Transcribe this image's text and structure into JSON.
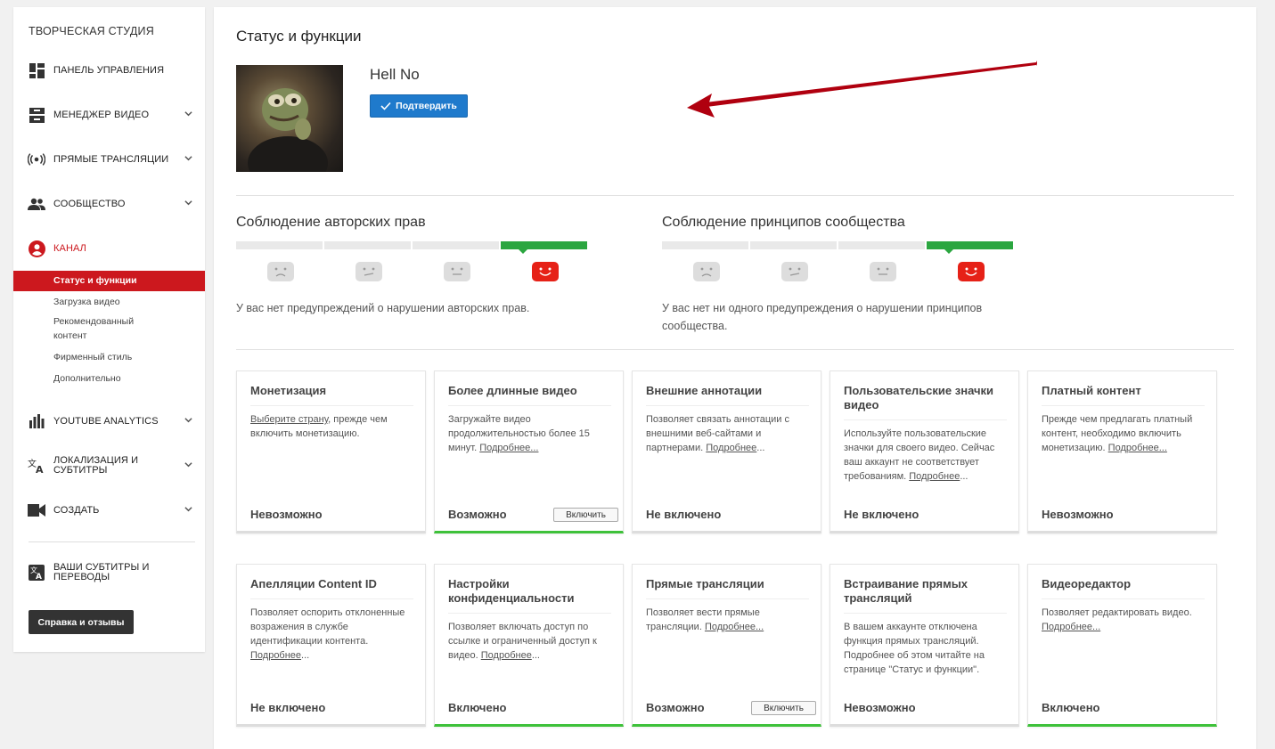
{
  "sidebar": {
    "title": "ТВОРЧЕСКАЯ СТУДИЯ",
    "items": [
      {
        "label": "ПАНЕЛЬ УПРАВЛЕНИЯ",
        "icon": "dashboard-icon"
      },
      {
        "label": "МЕНЕДЖЕР ВИДЕО",
        "icon": "video-manager-icon"
      },
      {
        "label": "ПРЯМЫЕ ТРАНСЛЯЦИИ",
        "icon": "live-icon"
      },
      {
        "label": "СООБЩЕСТВО",
        "icon": "community-icon"
      },
      {
        "label": "КАНАЛ",
        "icon": "channel-icon"
      },
      {
        "label": "YOUTUBE ANALYTICS",
        "icon": "analytics-icon"
      },
      {
        "label": "ЛОКАЛИЗАЦИЯ И СУБТИТРЫ",
        "icon": "translate-icon"
      },
      {
        "label": "СОЗДАТЬ",
        "icon": "create-icon"
      },
      {
        "label": "ВАШИ СУБТИТРЫ И ПЕРЕВОДЫ",
        "icon": "subtitles-icon"
      }
    ],
    "channel_sub": [
      "Статус и функции",
      "Загрузка видео",
      "Рекомендованный контент",
      "Фирменный стиль",
      "Дополнительно"
    ],
    "help_label": "Справка и отзывы"
  },
  "main": {
    "title": "Статус и функции",
    "channel_name": "Hell No",
    "verify_label": "Подтвердить",
    "copyright": {
      "title": "Соблюдение авторских прав",
      "text": "У вас нет предупреждений о нарушении авторских прав."
    },
    "community": {
      "title": "Соблюдение принципов сообщества",
      "text": "У вас нет ни одного предупреждения о нарушении принципов сообщества."
    }
  },
  "cards": [
    {
      "title": "Монетизация",
      "desc_pre": "",
      "link": "Выберите страну",
      "desc_post": ", прежде чем включить монетизацию.",
      "status": "Невозможно",
      "button": "",
      "green": false
    },
    {
      "title": "Более длинные видео",
      "desc_pre": "Загружайте видео продолжительностью более 15 минут. ",
      "link": "Подробнее...",
      "desc_post": "",
      "status": "Возможно",
      "button": "Включить",
      "green": true
    },
    {
      "title": "Внешние аннотации",
      "desc_pre": "Позволяет связать аннотации с внешними веб-сайтами и партнерами. ",
      "link": "Подробнее",
      "desc_post": "...",
      "status": "Не включено",
      "button": "",
      "green": false
    },
    {
      "title": "Пользовательские значки видео",
      "desc_pre": "Используйте пользовательские значки для своего видео. Сейчас ваш аккаунт не соответствует требованиям. ",
      "link": "Подробнее",
      "desc_post": "...",
      "status": "Не включено",
      "button": "",
      "green": false
    },
    {
      "title": "Платный контент",
      "desc_pre": "Прежде чем предлагать платный контент, необходимо включить монетизацию. ",
      "link": "Подробнее...",
      "desc_post": "",
      "status": "Невозможно",
      "button": "",
      "green": false
    },
    {
      "title": "Апелляции Content ID",
      "desc_pre": "Позволяет оспорить отклоненные возражения в службе идентификации контента. ",
      "link": "Подробнее",
      "desc_post": "...",
      "status": "Не включено",
      "button": "",
      "green": false
    },
    {
      "title": "Настройки конфиденциальности",
      "desc_pre": "Позволяет включать доступ по ссылке и ограниченный доступ к видео. ",
      "link": "Подробнее",
      "desc_post": "...",
      "status": "Включено",
      "button": "",
      "green": true
    },
    {
      "title": "Прямые трансляции",
      "desc_pre": "Позволяет вести прямые трансляции. ",
      "link": "Подробнее...",
      "desc_post": "",
      "status": "Возможно",
      "button": "Включить",
      "green": true
    },
    {
      "title": "Встраивание прямых трансляций",
      "desc_pre": "В вашем аккаунте отключена функция прямых трансляций. Подробнее об этом читайте на странице \"Статус и функции\".",
      "link": "",
      "desc_post": "",
      "status": "Невозможно",
      "button": "",
      "green": false
    },
    {
      "title": "Видеоредактор",
      "desc_pre": "Позволяет редактировать видео. ",
      "link": "Подробнее...",
      "desc_post": "",
      "status": "Включено",
      "button": "",
      "green": true
    }
  ],
  "colors": {
    "accent_red": "#cc181e",
    "verify_blue": "#1f7acc",
    "green": "#2ba640",
    "arrow_red": "#b0000f"
  }
}
